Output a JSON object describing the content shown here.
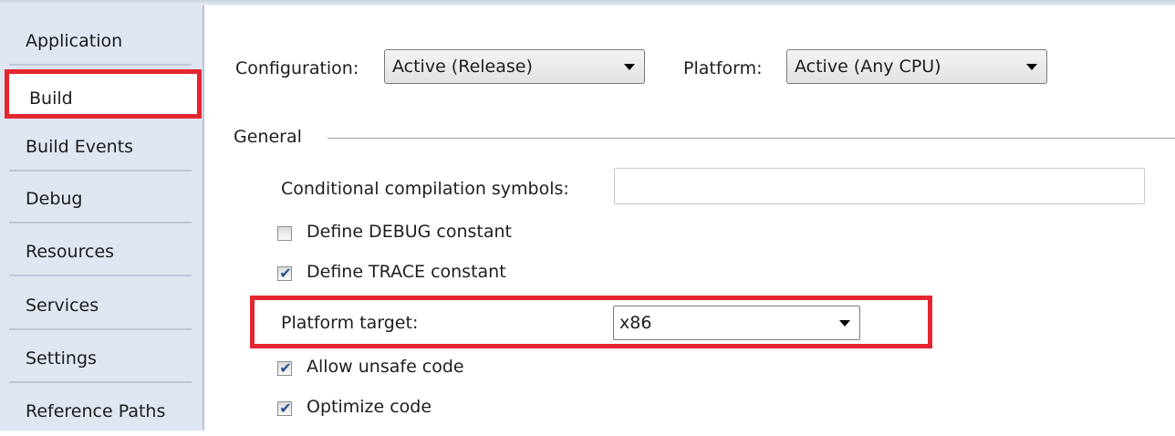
{
  "sidebar": {
    "items": [
      {
        "label": "Application"
      },
      {
        "label": "Build"
      },
      {
        "label": "Build Events"
      },
      {
        "label": "Debug"
      },
      {
        "label": "Resources"
      },
      {
        "label": "Services"
      },
      {
        "label": "Settings"
      },
      {
        "label": "Reference Paths"
      }
    ],
    "selected": "Build"
  },
  "toolbar": {
    "configuration_label": "Configuration:",
    "configuration_value": "Active (Release)",
    "platform_label": "Platform:",
    "platform_value": "Active (Any CPU)"
  },
  "general": {
    "section_title": "General",
    "symbols_label": "Conditional compilation symbols:",
    "symbols_value": "",
    "define_debug": {
      "label": "Define DEBUG constant",
      "checked": false
    },
    "define_trace": {
      "label": "Define TRACE constant",
      "checked": true
    },
    "platform_target_label": "Platform target:",
    "platform_target_value": "x86",
    "allow_unsafe": {
      "label": "Allow unsafe code",
      "checked": true
    },
    "optimize": {
      "label": "Optimize code",
      "checked": true
    }
  },
  "colors": {
    "highlight": "#e3262f",
    "sidebar_bg": "#dfe6f1",
    "check_mark": "#2b4f8c"
  }
}
